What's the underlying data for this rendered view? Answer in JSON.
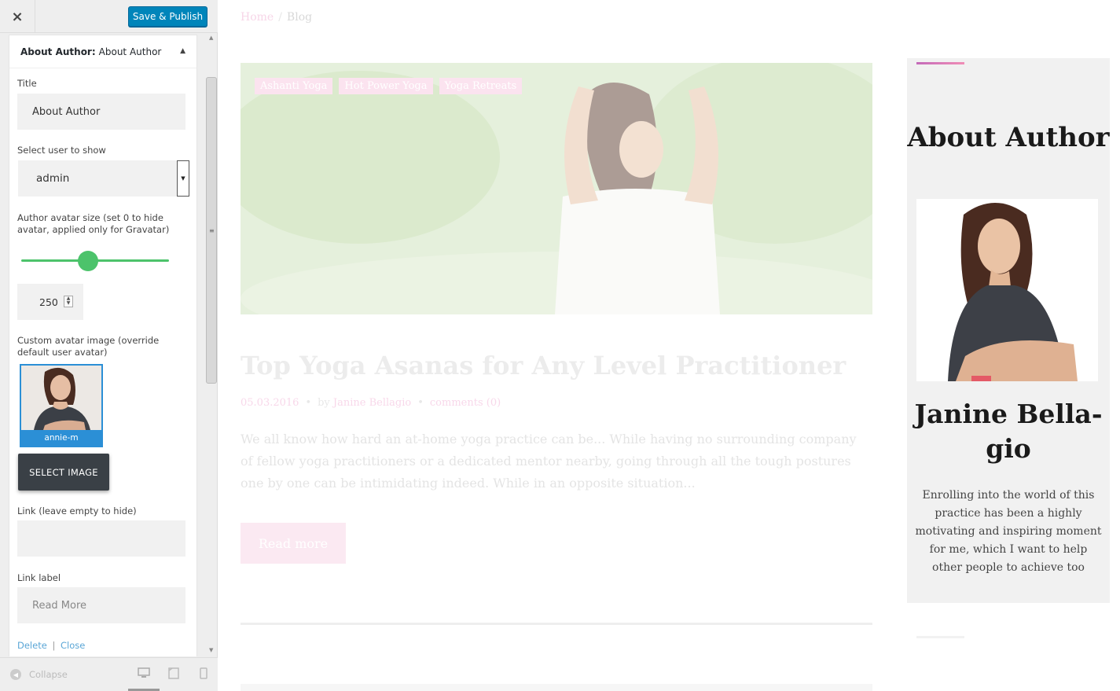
{
  "customizer": {
    "close_icon": "×",
    "save_label": "Save & Publish",
    "widget": {
      "header_bold": "About Author:",
      "header_title": "About Author",
      "title_label": "Title",
      "title_value": "About Author",
      "user_label": "Select user to show",
      "user_value": "admin",
      "avatar_size_label": "Author avatar size (set 0 to hide avatar, applied only for Gravatar)",
      "avatar_size_value": "250",
      "slider_fraction": 0.45,
      "custom_avatar_label": "Custom avatar image (override default user avatar)",
      "image_caption": "annie-m",
      "select_image_label": "SELECT IMAGE",
      "link_label": "Link (leave empty to hide)",
      "link_value": "",
      "link_label_label": "Link label",
      "link_label_placeholder": "Read More",
      "delete_label": "Delete",
      "separator": "|",
      "close_label": "Close"
    },
    "footer": {
      "collapse_label": "Collapse",
      "devices": [
        "desktop-icon",
        "tablet-icon",
        "mobile-icon"
      ]
    }
  },
  "preview": {
    "breadcrumb": {
      "home": "Home",
      "separator": "/",
      "current": "Blog"
    },
    "post": {
      "tags": [
        "Ashanti Yoga",
        "Hot Power Yoga",
        "Yoga Retreats"
      ],
      "title": "Top Yoga Asanas for Any Level Practitioner",
      "date": "05.03.2016",
      "by": "by",
      "author": "Janine Bellagio",
      "comments": "comments (0)",
      "excerpt": "We all know how hard an at-home yoga practice can be... While having no surrounding company of fellow yoga practitioners or a dedicated mentor nearby, going through all the tough postures one by one can be intimidating indeed. While in an opposite situation...",
      "read_more": "Read more"
    },
    "about_widget": {
      "title": "About Author",
      "name": "Janine Bella-gio",
      "bio": "Enrolling into the world of this practice has been a highly motivating and inspiring moment for me, which I want to help other people to achieve too"
    }
  },
  "colors": {
    "save_button": "#0085ba",
    "slider": "#4cc36b",
    "accent_pink": "#f08db6",
    "selected_image": "#2b8fd6"
  }
}
